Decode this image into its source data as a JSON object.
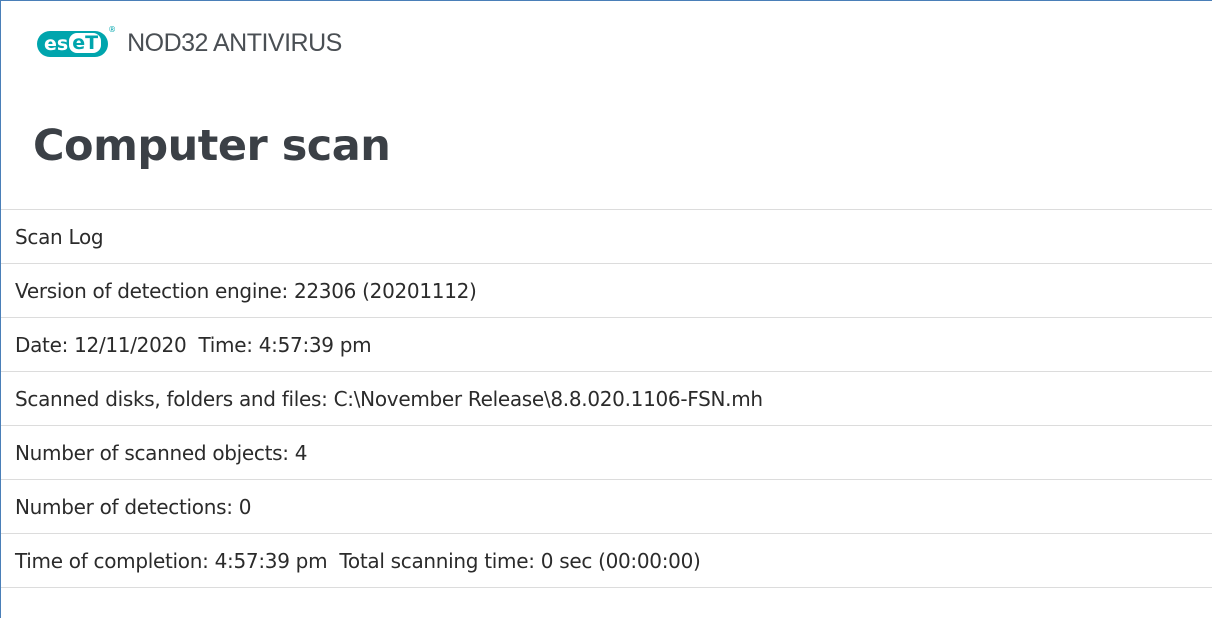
{
  "app": {
    "brand_logo_text": "eset",
    "product_name": "NOD32 ANTIVIRUS",
    "registered_mark": "®",
    "brand_color": "#00a5ad"
  },
  "page": {
    "title": "Computer scan"
  },
  "scan_log": {
    "rows": [
      "Scan Log",
      "Version of detection engine: 22306 (20201112)",
      "Date: 12/11/2020  Time: 4:57:39 pm",
      "Scanned disks, folders and files: C:\\November Release\\8.8.020.1106-FSN.mh",
      "Number of scanned objects: 4",
      "Number of detections: 0",
      "Time of completion: 4:57:39 pm  Total scanning time: 0 sec (00:00:00)"
    ]
  }
}
